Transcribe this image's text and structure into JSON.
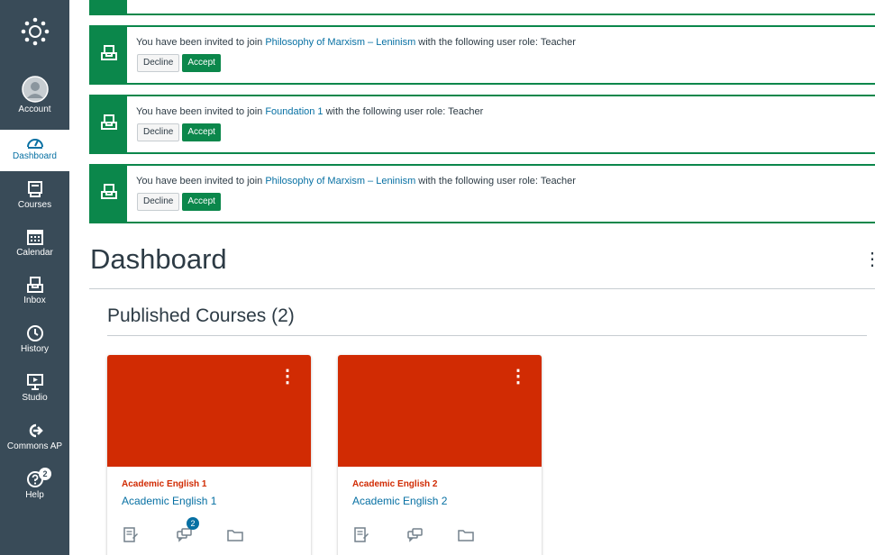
{
  "nav": {
    "items": [
      {
        "label": "Account",
        "icon": "account-icon"
      },
      {
        "label": "Dashboard",
        "icon": "dashboard-icon"
      },
      {
        "label": "Courses",
        "icon": "courses-icon"
      },
      {
        "label": "Calendar",
        "icon": "calendar-icon"
      },
      {
        "label": "Inbox",
        "icon": "inbox-icon"
      },
      {
        "label": "History",
        "icon": "history-icon"
      },
      {
        "label": "Studio",
        "icon": "studio-icon"
      },
      {
        "label": "Commons AP",
        "icon": "commons-icon"
      },
      {
        "label": "Help",
        "icon": "help-icon"
      }
    ],
    "help_badge": "2"
  },
  "invitations": [
    {
      "prefix": "You have been invited to join ",
      "course": "Philosophy of Marxism – Leninism",
      "suffix": " with the following user role: Teacher",
      "decline": "Decline",
      "accept": "Accept"
    },
    {
      "prefix": "You have been invited to join ",
      "course": "Foundation 1",
      "suffix": " with the following user role: Teacher",
      "decline": "Decline",
      "accept": "Accept"
    },
    {
      "prefix": "You have been invited to join ",
      "course": "Philosophy of Marxism – Leninism",
      "suffix": " with the following user role: Teacher",
      "decline": "Decline",
      "accept": "Accept"
    }
  ],
  "dashboard": {
    "title": "Dashboard",
    "published_heading": "Published Courses (2)"
  },
  "courses": [
    {
      "term": "Academic English 1",
      "name": "Academic English 1",
      "color": "#d12b03",
      "discussion_badge": "2"
    },
    {
      "term": "Academic English 2",
      "name": "Academic English 2",
      "color": "#d12b03",
      "discussion_badge": ""
    }
  ],
  "colors": {
    "nav_bg": "#394b58",
    "success": "#0b874b",
    "link": "#0770a3"
  }
}
